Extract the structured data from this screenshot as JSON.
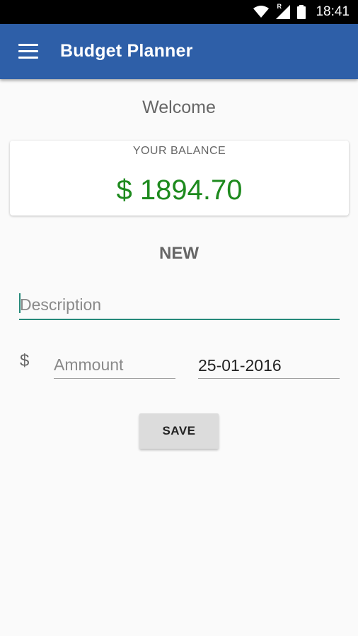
{
  "status_bar": {
    "time": "18:41",
    "network_indicator": "R",
    "icons": [
      "wifi-icon",
      "cell-signal-icon",
      "battery-icon"
    ]
  },
  "app_bar": {
    "title": "Budget Planner",
    "menu_icon": "hamburger-menu-icon",
    "color": "#2e5fa8"
  },
  "main": {
    "welcome": "Welcome",
    "balance": {
      "label": "YOUR BALANCE",
      "value": "$ 1894.70",
      "color": "#1e8a1e"
    },
    "new_section": {
      "heading": "NEW",
      "description_placeholder": "Description",
      "currency_symbol": "$",
      "amount_placeholder": "Ammount",
      "date_value": "25-01-2016",
      "save_label": "SAVE"
    }
  },
  "colors": {
    "accent": "#26897a",
    "background": "#fafafa"
  }
}
